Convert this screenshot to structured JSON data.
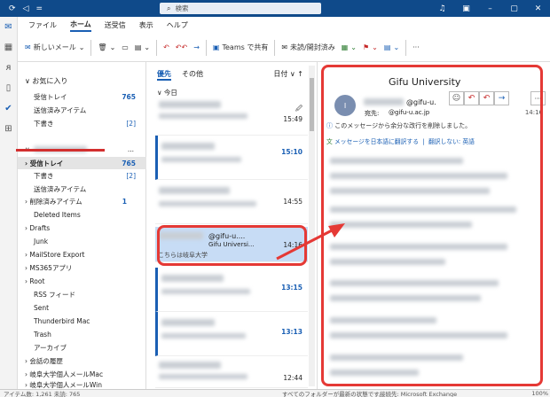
{
  "titlebar": {
    "quick_icons": [
      "⟳",
      "◁",
      "="
    ],
    "search_placeholder": "検索",
    "window_icons": [
      "♫",
      "▣",
      "–",
      "▢",
      "✕"
    ]
  },
  "ribbon_tabs": [
    "ファイル",
    "ホーム",
    "送受信",
    "表示",
    "ヘルプ"
  ],
  "ribbon": {
    "new_mail": "新しいメール",
    "teams_share": "Teams で共有",
    "unread_read": "未読/開封済み"
  },
  "rail_icons": [
    "✉",
    "▦",
    "ᴙ",
    "▯",
    "✔",
    "⊞"
  ],
  "folders": {
    "favorites_header": "お気に入り",
    "fav_inbox": {
      "label": "受信トレイ",
      "count": "765"
    },
    "fav_sent": "送信済みアイテム",
    "fav_drafts": {
      "label": "下書き",
      "count": "[2]"
    },
    "account_more": "...",
    "inbox": {
      "label": "受信トレイ",
      "count": "765"
    },
    "drafts": {
      "label": "下書き",
      "count": "[2]"
    },
    "sent": "送信済みアイテム",
    "deleted": {
      "label": "削除済みアイテム",
      "count": "1"
    },
    "deleted_items": "Deleted Items",
    "list": [
      "Drafts",
      "Junk",
      "MailStore Export",
      "MS365アプリ",
      "Root",
      "RSS フィード",
      "Sent",
      "Thunderbird Mac",
      "Trash",
      "アーカイブ",
      "会話の履歴",
      "岐阜大学個人メールMac",
      "岐阜大学個人メールWin"
    ]
  },
  "message_list": {
    "focused_tab": "優先",
    "other_tab": "その他",
    "sort_label": "日付 ∨ ↑",
    "group": "今日",
    "messages": [
      {
        "time": "15:49",
        "attach": "🖉"
      },
      {
        "time": "15:10"
      },
      {
        "time": "14:55"
      },
      {
        "time": "14:16",
        "sender": "@gifu-u....",
        "subject": "Gifu Universi...",
        "preview": "こちらは岐阜大学"
      },
      {
        "time": "13:15"
      },
      {
        "time": "13:13"
      },
      {
        "time": "12:44"
      }
    ]
  },
  "reading": {
    "subject": "Gifu University",
    "avatar_initial": "I",
    "from": "@gifu-u.",
    "to_label": "宛先:",
    "to": "@gifu-u.ac.jp",
    "time": "14:16",
    "info": "このメッセージから余分な改行を削除しました。",
    "translate": "メッセージを日本語に翻訳する",
    "no_translate": "翻訳しない: 英語"
  },
  "status": {
    "left": "アイテム数: 1,261  未読: 765",
    "middle": "すべてのフォルダーが最新の状態です。",
    "right": "接続先: Microsoft Exchange",
    "zoom": "100%"
  },
  "colors": {
    "accent": "#1a5fb4",
    "titlebar": "#0f4a8a",
    "highlight": "#e53935"
  }
}
